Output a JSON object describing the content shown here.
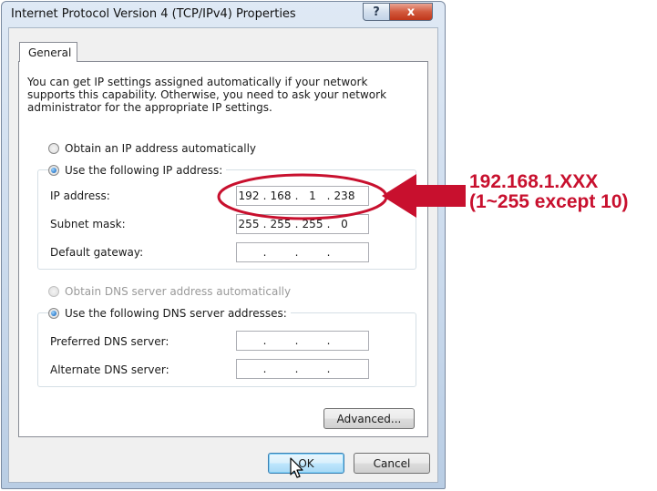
{
  "window": {
    "title": "Internet Protocol Version 4 (TCP/IPv4) Properties",
    "help_label": "?",
    "close_label": "x"
  },
  "tabs": [
    {
      "label": "General",
      "selected": true
    }
  ],
  "description": "You can get IP settings assigned automatically if your network supports this capability. Otherwise, you need to ask your network administrator for the appropriate IP settings.",
  "ip_section": {
    "auto_option": {
      "label": "Obtain an IP address automatically",
      "checked": false
    },
    "manual_option": {
      "label": "Use the following IP address:",
      "checked": true
    },
    "fields": [
      {
        "label": "IP address:",
        "octets": [
          "192",
          "168",
          "1",
          "238"
        ]
      },
      {
        "label": "Subnet mask:",
        "octets": [
          "255",
          "255",
          "255",
          "0"
        ]
      },
      {
        "label": "Default gateway:",
        "octets": [
          "",
          "",
          "",
          ""
        ]
      }
    ]
  },
  "dns_section": {
    "auto_option": {
      "label": "Obtain DNS server address automatically",
      "checked": false,
      "enabled": false
    },
    "manual_option": {
      "label": "Use the following DNS server addresses:",
      "checked": true
    },
    "fields": [
      {
        "label": "Preferred DNS server:",
        "octets": [
          "",
          "",
          "",
          ""
        ]
      },
      {
        "label": "Alternate DNS server:",
        "octets": [
          "",
          "",
          "",
          ""
        ]
      }
    ]
  },
  "buttons": {
    "advanced": "Advanced...",
    "ok": "OK",
    "cancel": "Cancel"
  },
  "annotation": {
    "line1": "192.168.1.XXX",
    "line2": "(1~255 except 10)",
    "color": "#c8102e"
  },
  "dot_char": "."
}
